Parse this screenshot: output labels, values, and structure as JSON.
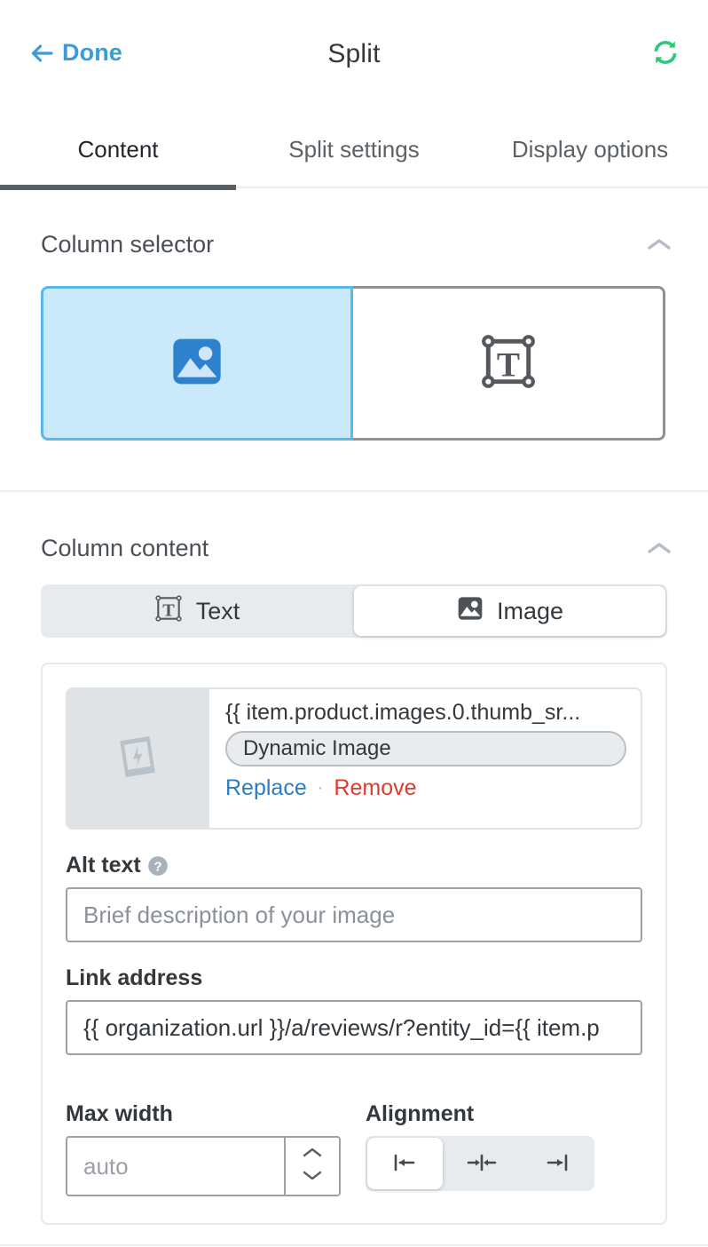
{
  "header": {
    "back_label": "Done",
    "title": "Split",
    "back_icon": "arrow-left-icon",
    "refresh_icon": "refresh-sync-icon",
    "accent_blue": "#3b9cd9",
    "accent_green": "#2fc878"
  },
  "tabs": [
    {
      "label": "Content",
      "active": true
    },
    {
      "label": "Split settings",
      "active": false
    },
    {
      "label": "Display options",
      "active": false
    }
  ],
  "column_selector": {
    "title": "Column selector",
    "collapse_icon": "chevron-up-icon",
    "tiles": [
      {
        "icon": "image-icon",
        "selected": true
      },
      {
        "icon": "text-box-icon",
        "selected": false
      }
    ],
    "selected_color": "#cae9fb",
    "selected_border": "#5bb8ee"
  },
  "column_content": {
    "title": "Column content",
    "collapse_icon": "chevron-up-icon",
    "segments": [
      {
        "label": "Text",
        "icon": "text-box-icon",
        "active": false
      },
      {
        "label": "Image",
        "icon": "image-icon",
        "active": true
      }
    ],
    "image": {
      "thumb_icon": "dynamic-image-placeholder-icon",
      "path": "{{ item.product.images.0.thumb_sr...",
      "badge": "Dynamic Image",
      "replace_label": "Replace",
      "separator": "·",
      "remove_label": "Remove",
      "replace_color": "#2b7cc4",
      "remove_color": "#dd3c2e"
    },
    "alt_text": {
      "label": "Alt text",
      "help_icon": "help-circle-icon",
      "value": "",
      "placeholder": "Brief description of your image"
    },
    "link_address": {
      "label": "Link address",
      "value": "{{ organization.url }}/a/reviews/r?entity_id={{ item.p",
      "placeholder": ""
    },
    "max_width": {
      "label": "Max width",
      "value": "",
      "placeholder": "auto",
      "stepper_up_icon": "chevron-up-icon",
      "stepper_down_icon": "chevron-down-icon"
    },
    "alignment": {
      "label": "Alignment",
      "options": [
        {
          "icon": "align-left-icon",
          "active": true
        },
        {
          "icon": "align-center-icon",
          "active": false
        },
        {
          "icon": "align-right-icon",
          "active": false
        }
      ]
    }
  }
}
